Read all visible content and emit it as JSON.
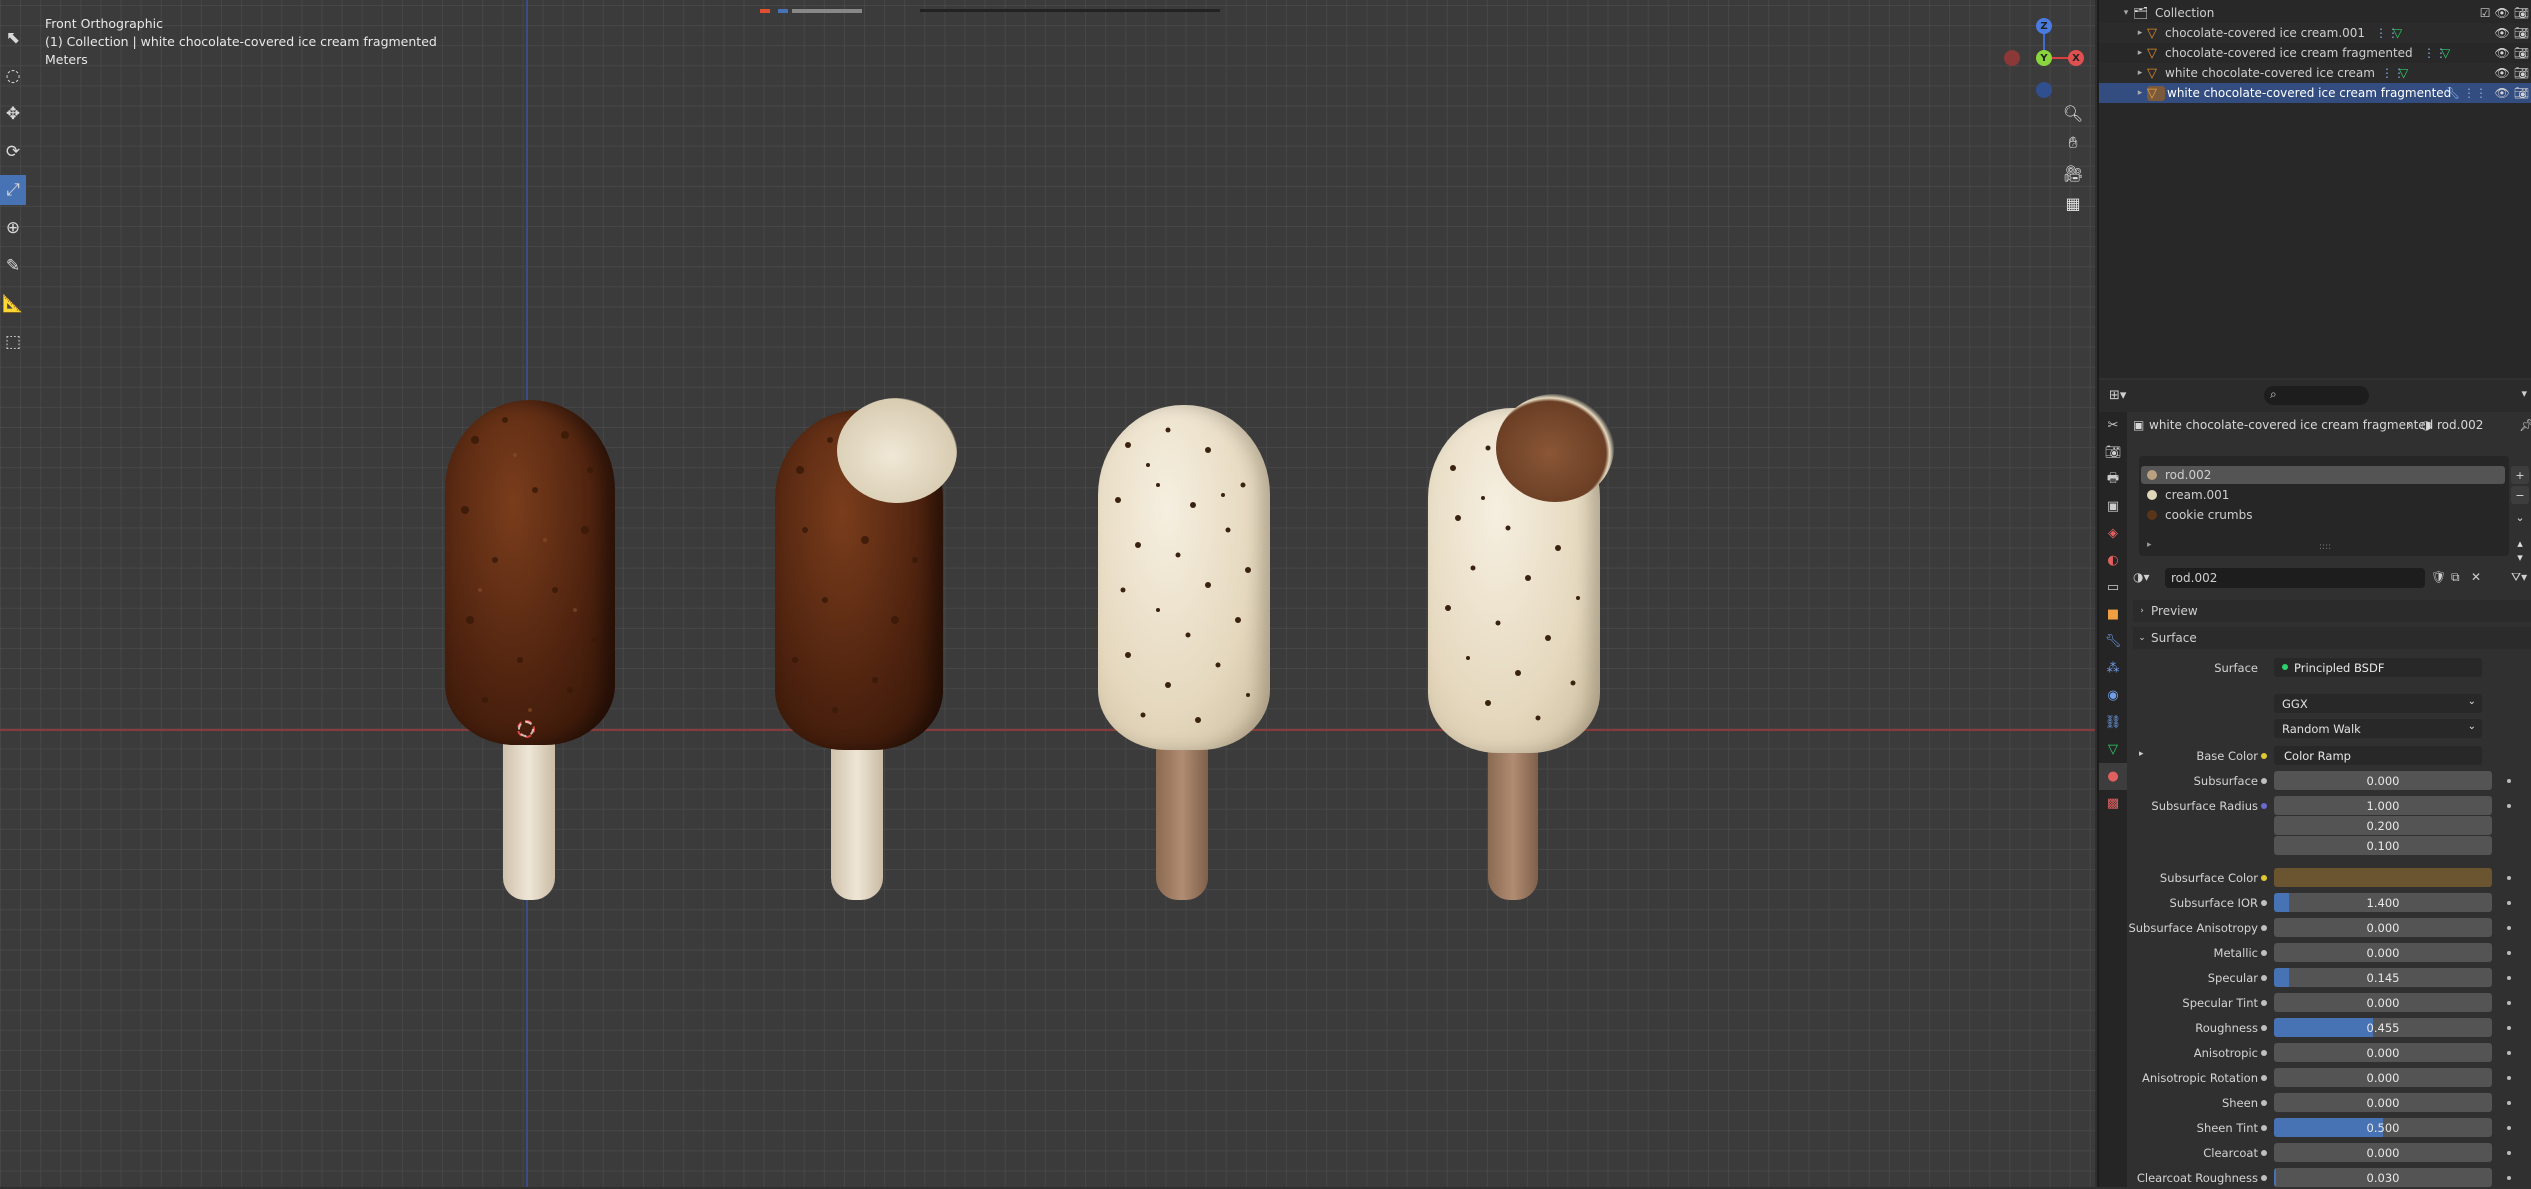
{
  "viewport": {
    "view_name": "Front Orthographic",
    "collection_info": "(1) Collection | white chocolate-covered ice cream fragmented",
    "units": "Meters",
    "gizmo": {
      "z": "Z",
      "y": "Y",
      "x": "X"
    }
  },
  "outliner": {
    "collection": "Collection",
    "items": [
      {
        "label": "chocolate-covered ice cream.001"
      },
      {
        "label": "chocolate-covered ice cream fragmented"
      },
      {
        "label": "white chocolate-covered ice cream"
      },
      {
        "label": "white chocolate-covered ice cream fragmented"
      }
    ]
  },
  "properties": {
    "search_placeholder": "",
    "breadcrumb_object": "white chocolate-covered ice cream fragmented",
    "breadcrumb_material": "rod.002",
    "slots": [
      {
        "label": "rod.002",
        "color": "#b8a080"
      },
      {
        "label": "cream.001",
        "color": "#e0d6b8"
      },
      {
        "label": "cookie crumbs",
        "color": "#5a3418"
      }
    ],
    "material_name": "rod.002",
    "preview_label": "Preview",
    "surface_label": "Surface",
    "surface_row": {
      "label": "Surface",
      "value": "Principled BSDF"
    },
    "distribution": "GGX",
    "subsurface_method": "Random Walk",
    "base_color": {
      "label": "Base Color",
      "value": "Color Ramp"
    },
    "subsurface_color": {
      "label": "Subsurface Color",
      "color": "#6b5430"
    },
    "subsurface_radius": {
      "label": "Subsurface Radius",
      "values": [
        "1.000",
        "0.200",
        "0.100"
      ]
    },
    "fields": [
      {
        "label": "Subsurface",
        "value": "0.000",
        "fill": 0.0
      },
      {
        "label": "Subsurface IOR",
        "value": "1.400",
        "fill": 0.07
      },
      {
        "label": "Subsurface Anisotropy",
        "value": "0.000",
        "fill": 0.0
      },
      {
        "label": "Metallic",
        "value": "0.000",
        "fill": 0.0
      },
      {
        "label": "Specular",
        "value": "0.145",
        "fill": 0.07
      },
      {
        "label": "Specular Tint",
        "value": "0.000",
        "fill": 0.0
      },
      {
        "label": "Roughness",
        "value": "0.455",
        "fill": 0.455
      },
      {
        "label": "Anisotropic",
        "value": "0.000",
        "fill": 0.0
      },
      {
        "label": "Anisotropic Rotation",
        "value": "0.000",
        "fill": 0.0
      },
      {
        "label": "Sheen",
        "value": "0.000",
        "fill": 0.0
      },
      {
        "label": "Sheen Tint",
        "value": "0.500",
        "fill": 0.5
      },
      {
        "label": "Clearcoat",
        "value": "0.000",
        "fill": 0.0
      },
      {
        "label": "Clearcoat Roughness",
        "value": "0.030",
        "fill": 0.01
      }
    ]
  },
  "colors": {
    "accent": "#4772b3",
    "milk_chocolate": "#5a2a12",
    "white_chocolate": "#e8dcc4",
    "stick_light": "#e2d6c2",
    "stick_dark": "#9c7a62"
  }
}
